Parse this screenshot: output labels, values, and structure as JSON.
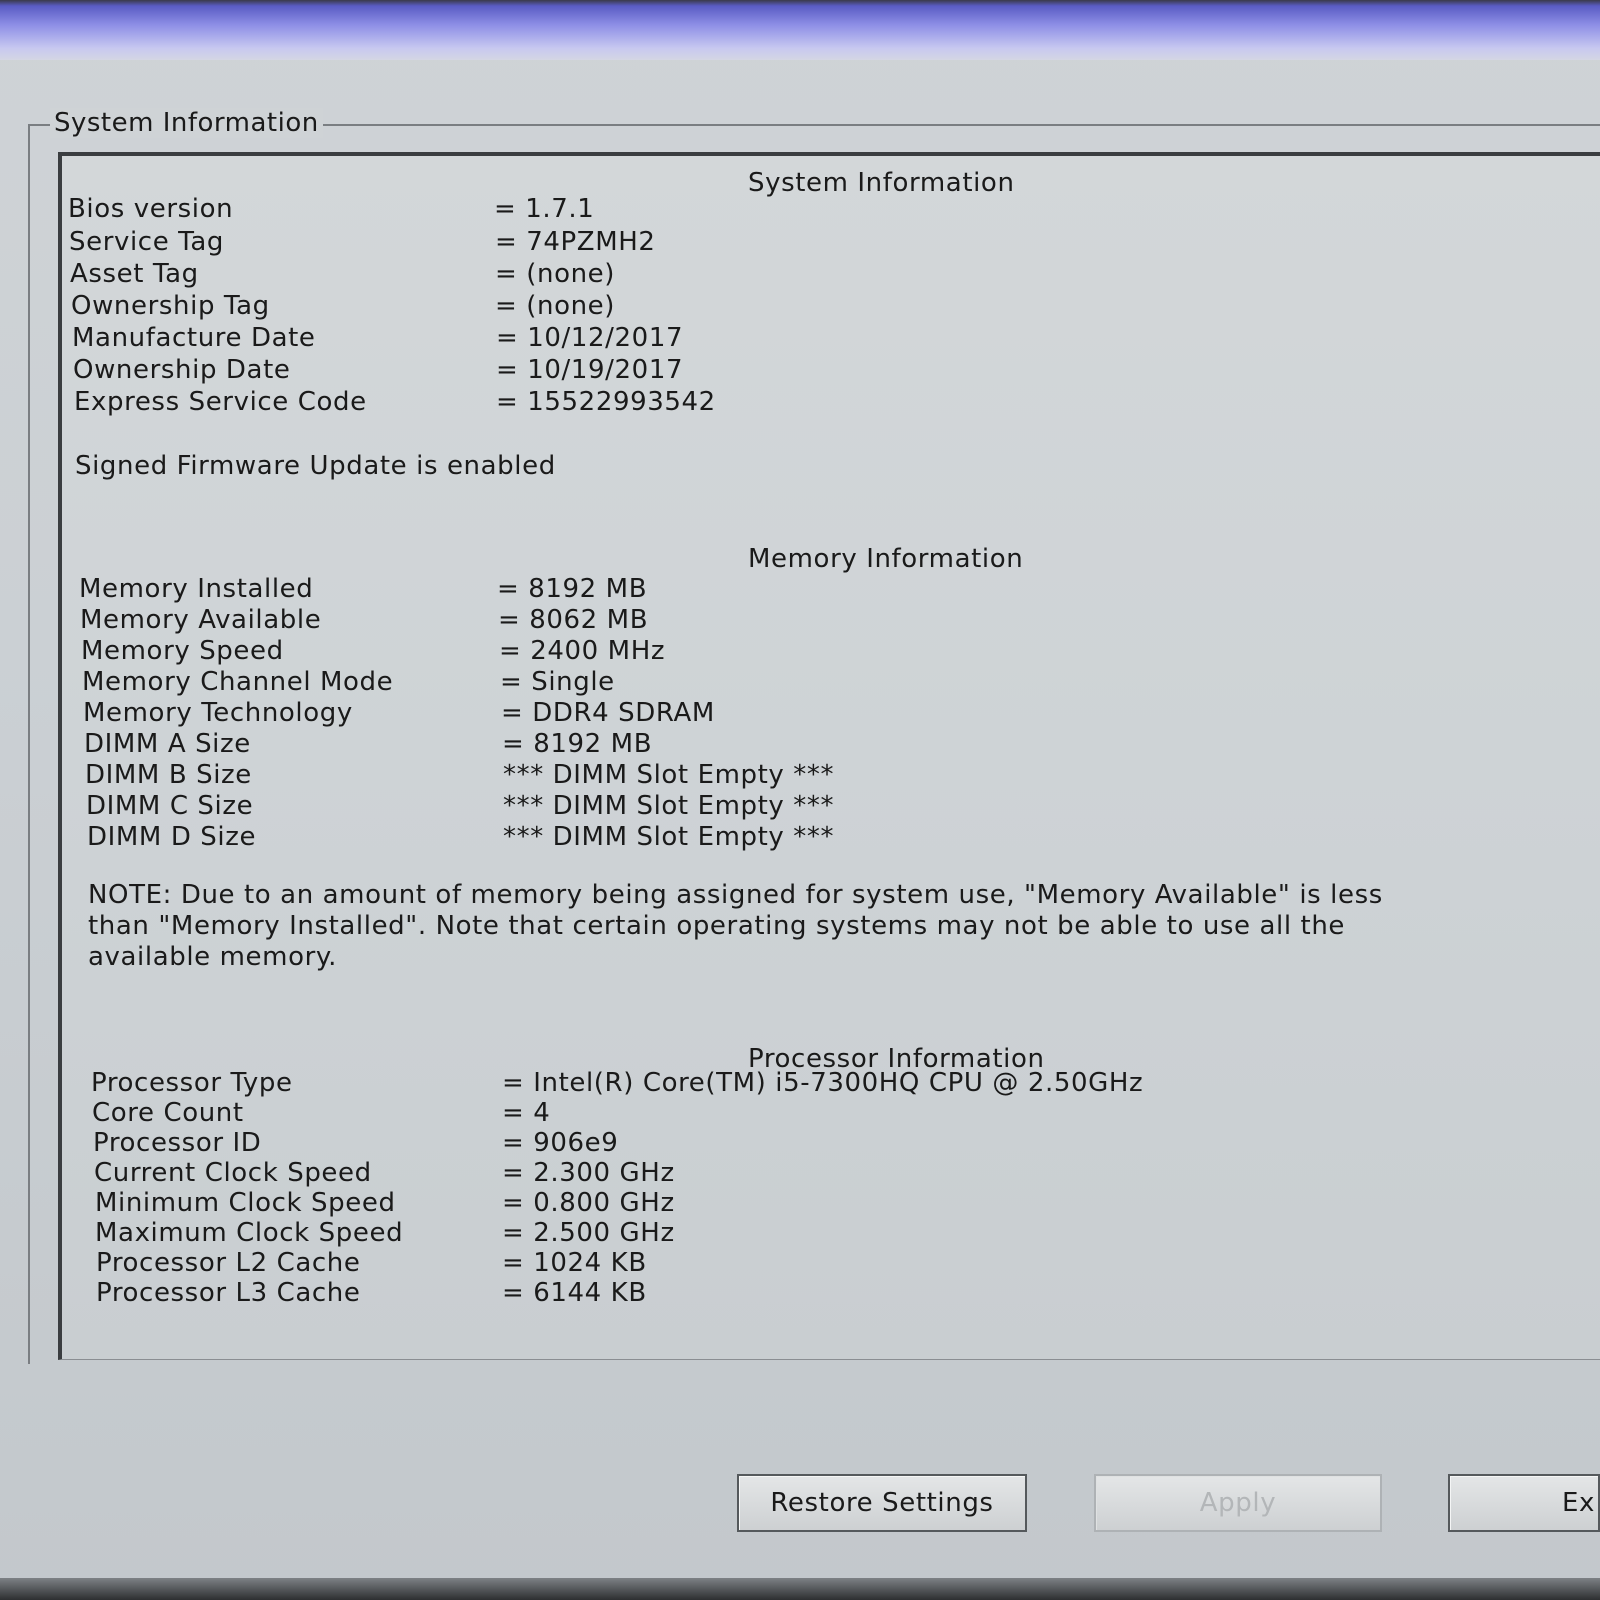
{
  "groupbox": {
    "title": "System Information"
  },
  "system": {
    "title": "System Information",
    "rows": [
      {
        "label": "Bios version",
        "value": "= 1.7.1"
      },
      {
        "label": "Service Tag",
        "value": "= 74PZMH2"
      },
      {
        "label": "Asset Tag",
        "value": "= (none)"
      },
      {
        "label": "Ownership Tag",
        "value": "= (none)"
      },
      {
        "label": "Manufacture Date",
        "value": "= 10/12/2017"
      },
      {
        "label": "Ownership Date",
        "value": "= 10/19/2017"
      },
      {
        "label": "Express Service Code",
        "value": "= 15522993542"
      }
    ],
    "firmware_note": "Signed Firmware Update is enabled"
  },
  "memory": {
    "title": "Memory Information",
    "rows": [
      {
        "label": "Memory Installed",
        "value": "= 8192 MB"
      },
      {
        "label": "Memory Available",
        "value": "= 8062 MB"
      },
      {
        "label": "Memory Speed",
        "value": "= 2400 MHz"
      },
      {
        "label": "Memory Channel Mode",
        "value": "= Single"
      },
      {
        "label": "Memory Technology",
        "value": "= DDR4 SDRAM"
      },
      {
        "label": "DIMM A Size",
        "value": "= 8192 MB"
      },
      {
        "label": "DIMM B Size",
        "value": "*** DIMM Slot Empty ***"
      },
      {
        "label": "DIMM C Size",
        "value": "*** DIMM Slot Empty ***"
      },
      {
        "label": "DIMM D Size",
        "value": "*** DIMM Slot Empty ***"
      }
    ],
    "note_lines": [
      "NOTE: Due to an amount of memory being assigned for system use, \"Memory Available\" is less",
      "than \"Memory Installed\". Note that certain operating systems may not be able to use all the",
      "available memory."
    ]
  },
  "processor": {
    "title": "Processor Information",
    "rows": [
      {
        "label": "Processor Type",
        "value": "= Intel(R) Core(TM) i5-7300HQ CPU @ 2.50GHz"
      },
      {
        "label": "Core Count",
        "value": "= 4"
      },
      {
        "label": "Processor ID",
        "value": "= 906e9"
      },
      {
        "label": "Current Clock Speed",
        "value": "= 2.300 GHz"
      },
      {
        "label": "Minimum Clock Speed",
        "value": "= 0.800 GHz"
      },
      {
        "label": "Maximum Clock Speed",
        "value": "= 2.500 GHz"
      },
      {
        "label": "Processor L2 Cache",
        "value": "= 1024 KB"
      },
      {
        "label": "Processor L3 Cache",
        "value": "= 6144 KB"
      }
    ]
  },
  "buttons": {
    "restore_label": "Restore Settings",
    "apply_label": "Apply",
    "exit_label": "Ex"
  }
}
